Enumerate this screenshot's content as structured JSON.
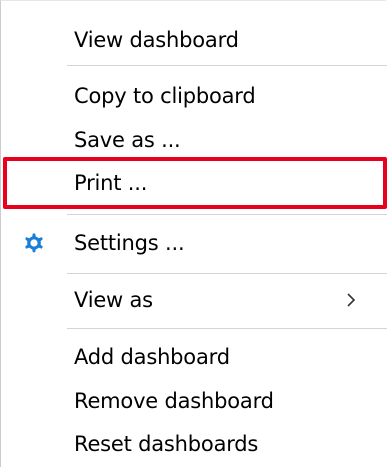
{
  "menu": {
    "items": [
      {
        "label": "View dashboard"
      },
      {
        "label": "Copy to clipboard"
      },
      {
        "label": "Save as ..."
      },
      {
        "label": "Print ..."
      },
      {
        "label": "Settings ...",
        "icon": "gear-icon",
        "icon_color": "#1a7fd6"
      },
      {
        "label": "View as",
        "submenu_icon": "chevron-right-icon"
      },
      {
        "label": "Add dashboard"
      },
      {
        "label": "Remove dashboard"
      },
      {
        "label": "Reset dashboards"
      }
    ],
    "highlighted_item": "Print ...",
    "highlight_color": "#e8001c"
  }
}
